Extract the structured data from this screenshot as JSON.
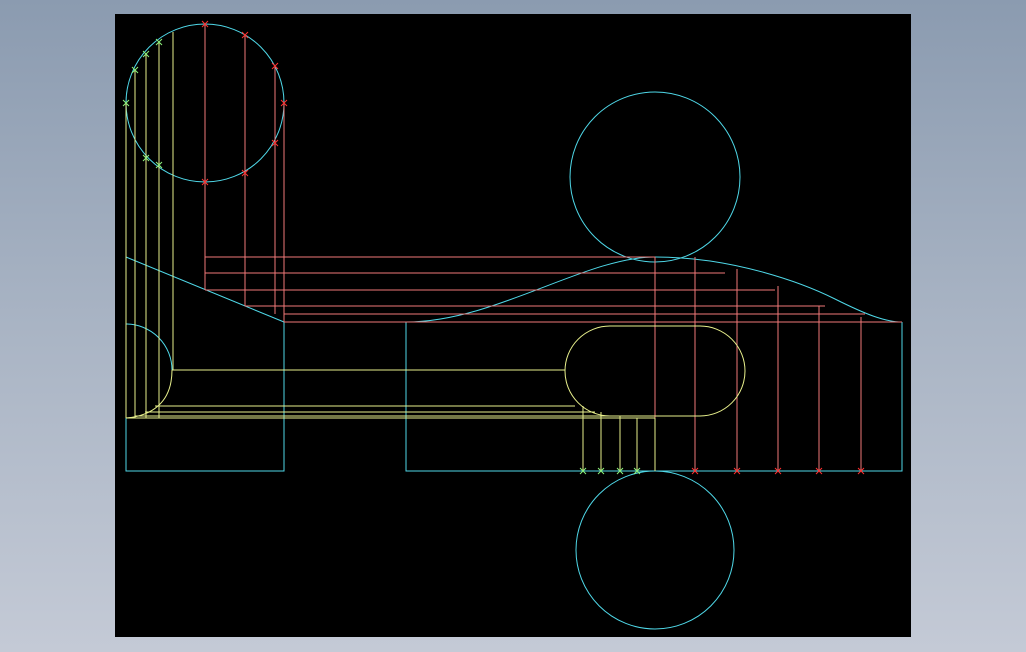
{
  "window": {
    "background": "gradient-grey-blue"
  },
  "drawing": {
    "background_color": "#000000",
    "colors": {
      "outline": "#4fd8e8",
      "projection_red": "#f07878",
      "projection_yellow": "#e8f08c",
      "marker_red": "#ff3030",
      "marker_green": "#8cf07a"
    },
    "elements": [
      "top-left-circle",
      "right-upper-circle",
      "right-lower-circle",
      "rounded-slot",
      "sloped-profile",
      "wave-profile",
      "left-base-rectangle",
      "right-base-rectangle",
      "projection-lines",
      "intersection-markers"
    ]
  }
}
